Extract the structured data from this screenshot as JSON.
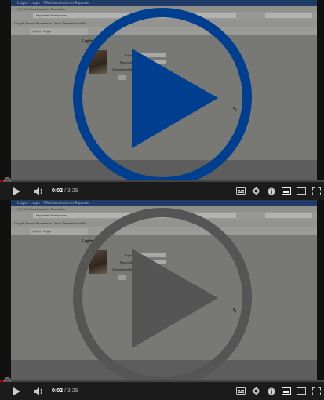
{
  "players": [
    {
      "overlay_color": "#003f8f",
      "browser": {
        "window_title": "Login - Login - Windows Internet Explorer",
        "menu": "File   Edit   View   Favorites   Tools   Help",
        "address": "http://web.thumb.com/",
        "toolbar": "Google          Search   Bookmarks   Check   Translate   AutoFill",
        "tab": "Login - Login",
        "login": {
          "title": "Login",
          "fields": [
            "Login",
            "Password",
            "Organization Id"
          ]
        }
      },
      "progress": 0.01,
      "time_current": "0:02",
      "time_separator": " / ",
      "time_duration": "3:29"
    },
    {
      "overlay_color": "#555555",
      "browser": {
        "window_title": "Login - Login - Windows Internet Explorer",
        "menu": "File   Edit   View   Favorites   Tools   Help",
        "address": "http://web.thumb.com/",
        "toolbar": "Google          Search   Bookmarks   Check   Translate   AutoFill",
        "tab": "Login - Login",
        "login": {
          "title": "Login",
          "fields": [
            "Login",
            "Password",
            "Organization Id"
          ]
        }
      },
      "progress": 0.01,
      "time_current": "0:02",
      "time_separator": " / ",
      "time_duration": "3:29"
    }
  ],
  "icons": {
    "play": "play-icon",
    "volume": "volume-icon",
    "subtitles": "subtitles-icon",
    "settings": "gear-icon",
    "info": "info-icon",
    "miniplayer": "miniplayer-icon",
    "theater": "theater-icon",
    "fullscreen": "fullscreen-icon"
  }
}
